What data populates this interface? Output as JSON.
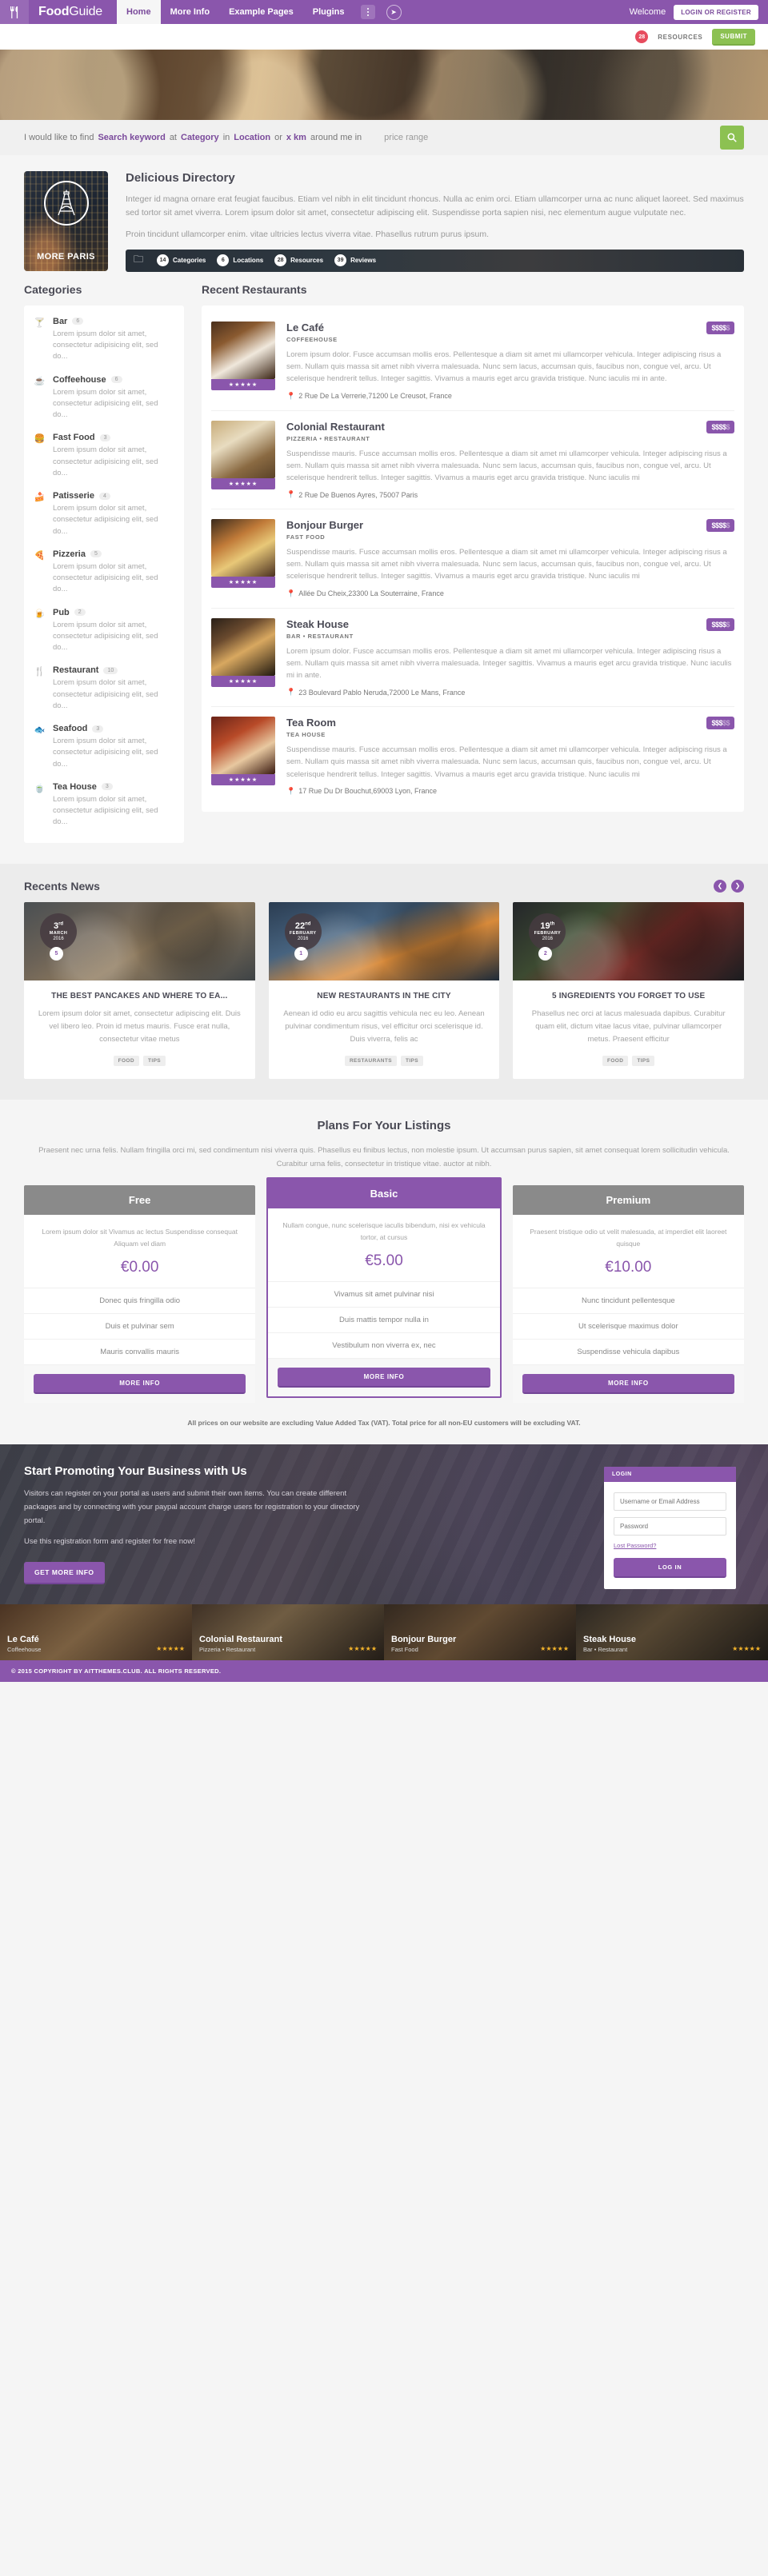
{
  "header": {
    "logo_icon": "fork-knife-icon",
    "brand_bold": "Food",
    "brand_light": "Guide",
    "nav": [
      {
        "label": "Home",
        "active": true
      },
      {
        "label": "More Info",
        "active": false
      },
      {
        "label": "Example Pages",
        "active": false
      },
      {
        "label": "Plugins",
        "active": false
      }
    ],
    "welcome": "Welcome",
    "login_button": "LOGIN OR REGISTER"
  },
  "subbar": {
    "count": "28",
    "resources_label": "RESOURCES",
    "submit_label": "SUBMIT"
  },
  "search": {
    "prefix": "I would like to find",
    "keyword": "Search keyword",
    "at": "at",
    "category": "Category",
    "in": "in",
    "location": "Location",
    "or": "or",
    "km": "x km",
    "around": "around me in",
    "price_range": "price range",
    "go_icon": "search-icon"
  },
  "directory": {
    "card_label": "MORE PARIS",
    "card_icon": "eiffel-tower-icon",
    "title": "Delicious Directory",
    "para1": "Integer id magna ornare erat feugiat faucibus. Etiam vel nibh in elit tincidunt rhoncus. Nulla ac enim orci. Etiam ullamcorper urna ac nunc aliquet laoreet. Sed maximus sed tortor sit amet viverra. Lorem ipsum dolor sit amet, consectetur adipiscing elit. Suspendisse porta sapien nisi, nec elementum augue vulputate nec.",
    "para2": "Proin tincidunt ullamcorper enim. vitae ultricies lectus viverra vitae. Phasellus rutrum purus ipsum.",
    "stats": [
      {
        "num": "14",
        "label": "Categories"
      },
      {
        "num": "6",
        "label": "Locations"
      },
      {
        "num": "28",
        "label": "Resources"
      },
      {
        "num": "39",
        "label": "Reviews"
      }
    ]
  },
  "categories": {
    "title": "Categories",
    "items": [
      {
        "name": "Bar",
        "count": "6",
        "icon": "cocktail-icon",
        "color": "#3bbfa8",
        "desc": "Lorem ipsum dolor sit amet, consectetur adipisicing elit, sed do..."
      },
      {
        "name": "Coffeehouse",
        "count": "6",
        "icon": "coffee-icon",
        "color": "#d89b73",
        "desc": "Lorem ipsum dolor sit amet, consectetur adipisicing elit, sed do..."
      },
      {
        "name": "Fast Food",
        "count": "3",
        "icon": "burger-icon",
        "color": "#e8c25a",
        "desc": "Lorem ipsum dolor sit amet, consectetur adipisicing elit, sed do..."
      },
      {
        "name": "Patisserie",
        "count": "4",
        "icon": "cake-icon",
        "color": "#e09aa8",
        "desc": "Lorem ipsum dolor sit amet, consectetur adipisicing elit, sed do..."
      },
      {
        "name": "Pizzeria",
        "count": "5",
        "icon": "pizza-icon",
        "color": "#e06a6a",
        "desc": "Lorem ipsum dolor sit amet, consectetur adipisicing elit, sed do..."
      },
      {
        "name": "Pub",
        "count": "2",
        "icon": "beer-icon",
        "color": "#e0a050",
        "desc": "Lorem ipsum dolor sit amet, consectetur adipisicing elit, sed do..."
      },
      {
        "name": "Restaurant",
        "count": "10",
        "icon": "cutlery-icon",
        "color": "#8a8a9a",
        "desc": "Lorem ipsum dolor sit amet, consectetur adipisicing elit, sed do..."
      },
      {
        "name": "Seafood",
        "count": "3",
        "icon": "fish-icon",
        "color": "#6aa8c8",
        "desc": "Lorem ipsum dolor sit amet, consectetur adipisicing elit, sed do..."
      },
      {
        "name": "Tea House",
        "count": "3",
        "icon": "tea-icon",
        "color": "#9ac85a",
        "desc": "Lorem ipsum dolor sit amet, consectetur adipisicing elit, sed do..."
      }
    ]
  },
  "restaurants": {
    "title": "Recent Restaurants",
    "items": [
      {
        "name": "Le Café",
        "category": "COFFEEHOUSE",
        "price": "$$$$",
        "price_off": "$",
        "stars": "★★★★★",
        "desc": "Lorem ipsum dolor. Fusce accumsan mollis eros. Pellentesque a diam sit amet mi ullamcorper vehicula. Integer adipiscing risus a sem. Nullam quis massa sit amet nibh viverra malesuada. Nunc sem lacus, accumsan quis, faucibus non, congue vel, arcu. Ut scelerisque hendrerit tellus. Integer sagittis. Vivamus a mauris eget arcu gravida tristique. Nunc iaculis mi in ante.",
        "address": "2 Rue De La Verrerie,71200 Le Creusot, France"
      },
      {
        "name": "Colonial Restaurant",
        "category": "PIZZERIA • RESTAURANT",
        "price": "$$$$",
        "price_off": "$",
        "stars": "★★★★★",
        "desc": "Suspendisse mauris. Fusce accumsan mollis eros. Pellentesque a diam sit amet mi ullamcorper vehicula. Integer adipiscing risus a sem. Nullam quis massa sit amet nibh viverra malesuada. Nunc sem lacus, accumsan quis, faucibus non, congue vel, arcu. Ut scelerisque hendrerit tellus. Integer sagittis. Vivamus a mauris eget arcu gravida tristique. Nunc iaculis mi",
        "address": "2 Rue De Buenos Ayres, 75007 Paris"
      },
      {
        "name": "Bonjour Burger",
        "category": "FAST FOOD",
        "price": "$$$$",
        "price_off": "$",
        "stars": "★★★★★",
        "desc": "Suspendisse mauris. Fusce accumsan mollis eros. Pellentesque a diam sit amet mi ullamcorper vehicula. Integer adipiscing risus a sem. Nullam quis massa sit amet nibh viverra malesuada. Nunc sem lacus, accumsan quis, faucibus non, congue vel, arcu. Ut scelerisque hendrerit tellus. Integer sagittis. Vivamus a mauris eget arcu gravida tristique. Nunc iaculis mi",
        "address": "Allée Du Cheix,23300 La Souterraine, France"
      },
      {
        "name": "Steak House",
        "category": "BAR • RESTAURANT",
        "price": "$$$$",
        "price_off": "$",
        "stars": "★★★★★",
        "desc": "Lorem ipsum dolor. Fusce accumsan mollis eros. Pellentesque a diam sit amet mi ullamcorper vehicula. Integer adipiscing risus a sem. Nullam quis massa sit amet nibh viverra malesuada. Integer sagittis. Vivamus a mauris eget arcu gravida tristique. Nunc iaculis mi in ante.",
        "address": "23 Boulevard Pablo Neruda,72000 Le Mans, France"
      },
      {
        "name": "Tea Room",
        "category": "TEA HOUSE",
        "price": "$$$",
        "price_off": "$$",
        "stars": "★★★★★",
        "desc": "Suspendisse mauris. Fusce accumsan mollis eros. Pellentesque a diam sit amet mi ullamcorper vehicula. Integer adipiscing risus a sem. Nullam quis massa sit amet nibh viverra malesuada. Nunc sem lacus, accumsan quis, faucibus non, congue vel, arcu. Ut scelerisque hendrerit tellus. Integer sagittis. Vivamus a mauris eget arcu gravida tristique. Nunc iaculis mi",
        "address": "17 Rue Du Dr Bouchut,69003 Lyon, France"
      }
    ]
  },
  "news": {
    "title": "Recents News",
    "prev_icon": "chevron-left-icon",
    "next_icon": "chevron-right-icon",
    "items": [
      {
        "day": "3",
        "day_sup": "rd",
        "month": "MARCH",
        "year": "2016",
        "comments": "5",
        "title": "THE BEST PANCAKES AND WHERE TO EA...",
        "excerpt": "Lorem ipsum dolor sit amet, consectetur adipiscing elit. Duis vel libero leo. Proin id metus mauris. Fusce erat nulla, consectetur vitae metus",
        "tags": [
          "FOOD",
          "TIPS"
        ]
      },
      {
        "day": "22",
        "day_sup": "nd",
        "month": "FEBRUARY",
        "year": "2016",
        "comments": "1",
        "title": "NEW RESTAURANTS IN THE CITY",
        "excerpt": "Aenean id odio eu arcu sagittis vehicula nec eu leo. Aenean pulvinar condimentum risus, vel efficitur orci scelerisque id. Duis viverra, felis ac",
        "tags": [
          "RESTAURANTS",
          "TIPS"
        ]
      },
      {
        "day": "19",
        "day_sup": "th",
        "month": "FEBRUARY",
        "year": "2016",
        "comments": "2",
        "title": "5 INGREDIENTS YOU FORGET TO USE",
        "excerpt": "Phasellus nec orci at lacus malesuada dapibus. Curabitur quam elit, dictum vitae lacus vitae, pulvinar ullamcorper metus. Praesent efficitur",
        "tags": [
          "FOOD",
          "TIPS"
        ]
      }
    ]
  },
  "plans": {
    "title": "Plans For Your Listings",
    "intro": "Praesent nec urna felis. Nullam fringilla orci mi, sed condimentum nisi viverra quis. Phasellus eu finibus lectus, non molestie ipsum. Ut accumsan purus sapien, sit amet consequat lorem sollicitudin vehicula. Curabitur urna felis, consectetur in tristique vitae. auctor at nibh.",
    "button_label": "MORE INFO",
    "vat_note": "All prices on our website are excluding Value Added Tax (VAT). Total price for all non-EU customers will be excluding VAT.",
    "items": [
      {
        "name": "Free",
        "desc": "Lorem ipsum dolor sit Vivamus ac lectus Suspendisse consequat Aliquam vel diam",
        "price": "€0.00",
        "features": [
          "Donec quis fringilla odio",
          "Duis et pulvinar sem",
          "Mauris convallis mauris"
        ],
        "featured": false
      },
      {
        "name": "Basic",
        "desc": "Nullam congue, nunc scelerisque iaculis bibendum, nisi ex vehicula tortor, at cursus",
        "price": "€5.00",
        "features": [
          "Vivamus sit amet pulvinar nisi",
          "Duis mattis tempor nulla in",
          "Vestibulum non viverra ex, nec"
        ],
        "featured": true
      },
      {
        "name": "Premium",
        "desc": "Praesent tristique odio ut velit malesuada, at imperdiet elit laoreet quisque",
        "price": "€10.00",
        "features": [
          "Nunc tincidunt pellentesque",
          "Ut scelerisque maximus dolor",
          "Suspendisse vehicula dapibus"
        ],
        "featured": false
      }
    ]
  },
  "promo": {
    "title": "Start Promoting Your Business with Us",
    "para1": "Visitors can register on your portal as users and submit their own items. You can create different packages and by connecting with your paypal account charge users for registration to your directory portal.",
    "para2": "Use this registration form and register for free now!",
    "button_label": "GET MORE INFO"
  },
  "login_form": {
    "tab_label": "LOGIN",
    "username_placeholder": "Username or Email Address",
    "password_placeholder": "Password",
    "lost_password": "Lost Password?",
    "submit_label": "LOG IN"
  },
  "featured_strip": [
    {
      "name": "Le Café",
      "category": "Coffeehouse",
      "stars": "★★★★★"
    },
    {
      "name": "Colonial Restaurant",
      "category": "Pizzeria • Restaurant",
      "stars": "★★★★★"
    },
    {
      "name": "Bonjour Burger",
      "category": "Fast Food",
      "stars": "★★★★★"
    },
    {
      "name": "Steak House",
      "category": "Bar • Restaurant",
      "stars": "★★★★★"
    }
  ],
  "copyright": "© 2015 COPYRIGHT BY AITTHEMES.CLUB. ALL RIGHTS RESERVED.",
  "colors": {
    "brand_purple": "#8a56ac",
    "green": "#8cc152",
    "red_badge": "#e74c5e",
    "dark_text": "#4a4a55"
  }
}
